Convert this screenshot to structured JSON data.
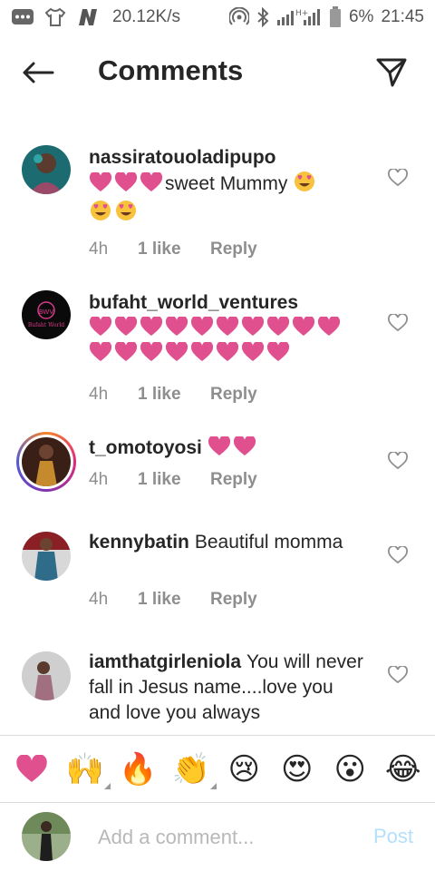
{
  "status_bar": {
    "net_speed": "20.12K/s",
    "battery": "6%",
    "time": "21:45"
  },
  "header": {
    "title": "Comments"
  },
  "colors": {
    "heart_pink": "#e0508f",
    "meta_gray": "#8e8e8e",
    "post_disabled": "#b2dffc"
  },
  "comments": [
    {
      "username": "nassiratouoladipupo",
      "text": "sweet Mummy",
      "time": "4h",
      "likes": "1 like",
      "reply": "Reply"
    },
    {
      "username": "bufaht_world_ventures",
      "text": "",
      "time": "4h",
      "likes": "1 like",
      "reply": "Reply"
    },
    {
      "username": "t_omotoyosi",
      "text": "",
      "time": "4h",
      "likes": "1 like",
      "reply": "Reply"
    },
    {
      "username": "kennybatin",
      "text": "Beautiful momma",
      "time": "4h",
      "likes": "1 like",
      "reply": "Reply"
    },
    {
      "username": "iamthatgirleniola",
      "text": "You will never fall in Jesus name....love you and love you always"
    }
  ],
  "emoji_bar": {
    "emojis": [
      "❤",
      "🙌",
      "🔥",
      "👏",
      "😢",
      "😍",
      "😮",
      "😂"
    ]
  },
  "composer": {
    "placeholder": "Add a comment...",
    "post_label": "Post"
  }
}
